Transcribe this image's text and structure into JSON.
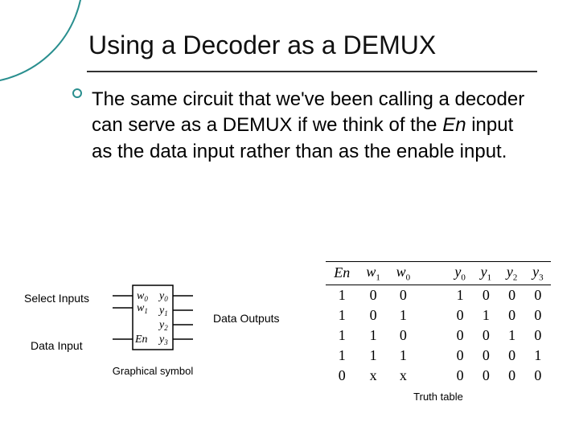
{
  "title": "Using a Decoder as a DEMUX",
  "paragraph_html": "The same circuit that we've been calling a decoder can serve as a DEMUX if we think of the <em>En</em> input as the data input rather than as the enable input.",
  "labels": {
    "select_inputs": "Select Inputs",
    "data_input": "Data Input",
    "data_outputs": "Data Outputs"
  },
  "symbol": {
    "inputs": [
      "w0",
      "w1",
      "En"
    ],
    "outputs": [
      "y0",
      "y1",
      "y2",
      "y3"
    ],
    "caption": "Graphical symbol"
  },
  "truth_table": {
    "headers_in": [
      "En",
      "w1",
      "w0"
    ],
    "headers_out": [
      "y0",
      "y1",
      "y2",
      "y3"
    ],
    "rows": [
      {
        "in": [
          "1",
          "0",
          "0"
        ],
        "out": [
          "1",
          "0",
          "0",
          "0"
        ]
      },
      {
        "in": [
          "1",
          "0",
          "1"
        ],
        "out": [
          "0",
          "1",
          "0",
          "0"
        ]
      },
      {
        "in": [
          "1",
          "1",
          "0"
        ],
        "out": [
          "0",
          "0",
          "1",
          "0"
        ]
      },
      {
        "in": [
          "1",
          "1",
          "1"
        ],
        "out": [
          "0",
          "0",
          "0",
          "1"
        ]
      },
      {
        "in": [
          "0",
          "x",
          "x"
        ],
        "out": [
          "0",
          "0",
          "0",
          "0"
        ]
      }
    ],
    "caption": "Truth table"
  }
}
